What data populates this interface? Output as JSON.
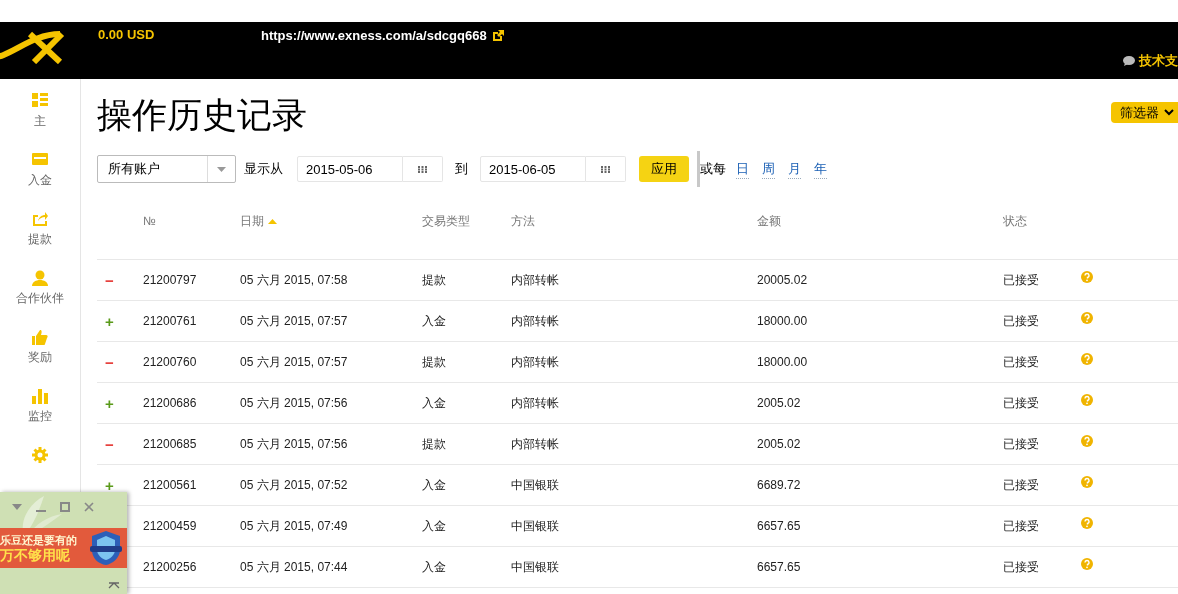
{
  "header": {
    "balance": "0.00 USD",
    "link": "https://www.exness.com/a/sdcgq668",
    "support": "技术支"
  },
  "sidebar": {
    "items": [
      {
        "label": "主"
      },
      {
        "label": "入金"
      },
      {
        "label": "提款"
      },
      {
        "label": "合作伙伴"
      },
      {
        "label": "奖励"
      },
      {
        "label": "监控"
      }
    ]
  },
  "page": {
    "title": "操作历史记录",
    "filter_button": "筛选器"
  },
  "filters": {
    "account": "所有账户",
    "from_label": "显示从",
    "from": "2015-05-06",
    "to_label": "到",
    "to": "2015-06-05",
    "apply": "应用",
    "or_each": "或每",
    "periods": [
      "日",
      "周",
      "月",
      "年"
    ]
  },
  "table": {
    "columns": [
      {
        "label": "№",
        "sorted": false
      },
      {
        "label": "日期",
        "sorted": true
      },
      {
        "label": "交易类型",
        "sorted": false
      },
      {
        "label": "方法",
        "sorted": false
      },
      {
        "label": "金额",
        "sorted": false
      },
      {
        "label": "状态",
        "sorted": false
      }
    ],
    "rows": [
      {
        "sign": "−",
        "color": "#e53935",
        "number": "21200797",
        "date": "05 六月 2015, 07:58",
        "type": "提款",
        "method": "内部转帐",
        "amount": "20005.02",
        "status": "已接受"
      },
      {
        "sign": "+",
        "color": "#5a9a1a",
        "number": "21200761",
        "date": "05 六月 2015, 07:57",
        "type": "入金",
        "method": "内部转帐",
        "amount": "18000.00",
        "status": "已接受"
      },
      {
        "sign": "−",
        "color": "#e53935",
        "number": "21200760",
        "date": "05 六月 2015, 07:57",
        "type": "提款",
        "method": "内部转帐",
        "amount": "18000.00",
        "status": "已接受"
      },
      {
        "sign": "+",
        "color": "#5a9a1a",
        "number": "21200686",
        "date": "05 六月 2015, 07:56",
        "type": "入金",
        "method": "内部转帐",
        "amount": "2005.02",
        "status": "已接受"
      },
      {
        "sign": "−",
        "color": "#e53935",
        "number": "21200685",
        "date": "05 六月 2015, 07:56",
        "type": "提款",
        "method": "内部转帐",
        "amount": "2005.02",
        "status": "已接受"
      },
      {
        "sign": "+",
        "color": "#5a9a1a",
        "number": "21200561",
        "date": "05 六月 2015, 07:52",
        "type": "入金",
        "method": "中国银联",
        "amount": "6689.72",
        "status": "已接受"
      },
      {
        "number": "21200459",
        "date": "05 六月 2015, 07:49",
        "type": "入金",
        "method": "中国银联",
        "amount": "6657.65",
        "status": "已接受"
      },
      {
        "number": "21200256",
        "date": "05 六月 2015, 07:44",
        "type": "入金",
        "method": "中国银联",
        "amount": "6657.65",
        "status": "已接受"
      }
    ]
  },
  "popup": {
    "lines": [
      "乐豆还是要有的",
      "万不够用呢"
    ]
  }
}
